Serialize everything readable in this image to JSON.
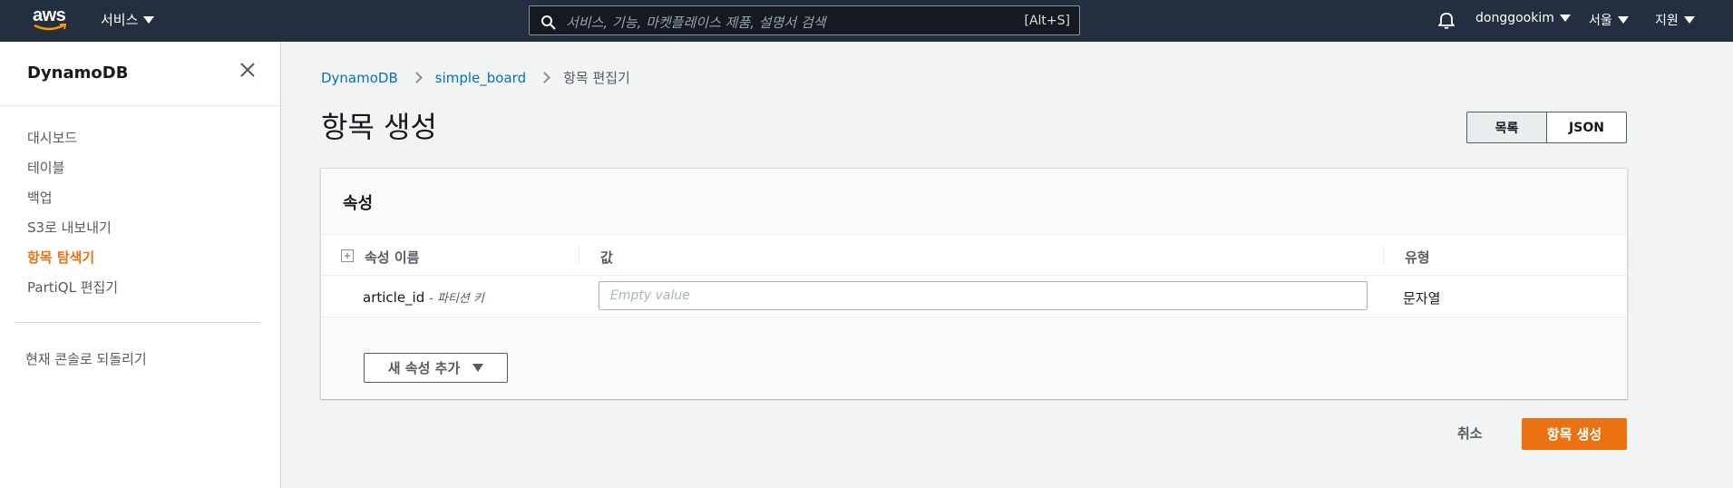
{
  "topnav": {
    "logo_text": "aws",
    "services_label": "서비스",
    "search_placeholder": "서비스, 기능, 마켓플레이스 제품, 설명서 검색",
    "search_shortcut": "[Alt+S]",
    "user_label": "donggookim",
    "region_label": "서울",
    "support_label": "지원"
  },
  "sidebar": {
    "title": "DynamoDB",
    "items": [
      {
        "label": "대시보드"
      },
      {
        "label": "테이블"
      },
      {
        "label": "백업"
      },
      {
        "label": "S3로 내보내기"
      },
      {
        "label": "항목 탐색기"
      },
      {
        "label": "PartiQL 편집기"
      }
    ],
    "active_index": 4,
    "footer_link": "현재 콘솔로 되돌리기"
  },
  "breadcrumb": [
    "DynamoDB",
    "simple_board",
    "항목 편집기"
  ],
  "page_title": "항목 생성",
  "view_toggle": {
    "list_label": "목록",
    "json_label": "JSON",
    "selected": "목록"
  },
  "attributes_panel": {
    "title": "속성",
    "columns": [
      "속성 이름",
      "값",
      "유형"
    ],
    "rows": [
      {
        "name": "article_id",
        "key_note": "- 파티션 키",
        "value": "",
        "value_placeholder": "Empty value",
        "type": "문자열"
      }
    ],
    "add_button_label": "새 속성 추가"
  },
  "actions": {
    "cancel_label": "취소",
    "create_label": "항목 생성"
  },
  "colors": {
    "nav_bg": "#232f3e",
    "accent": "#ec7211",
    "link": "#0073bb"
  }
}
